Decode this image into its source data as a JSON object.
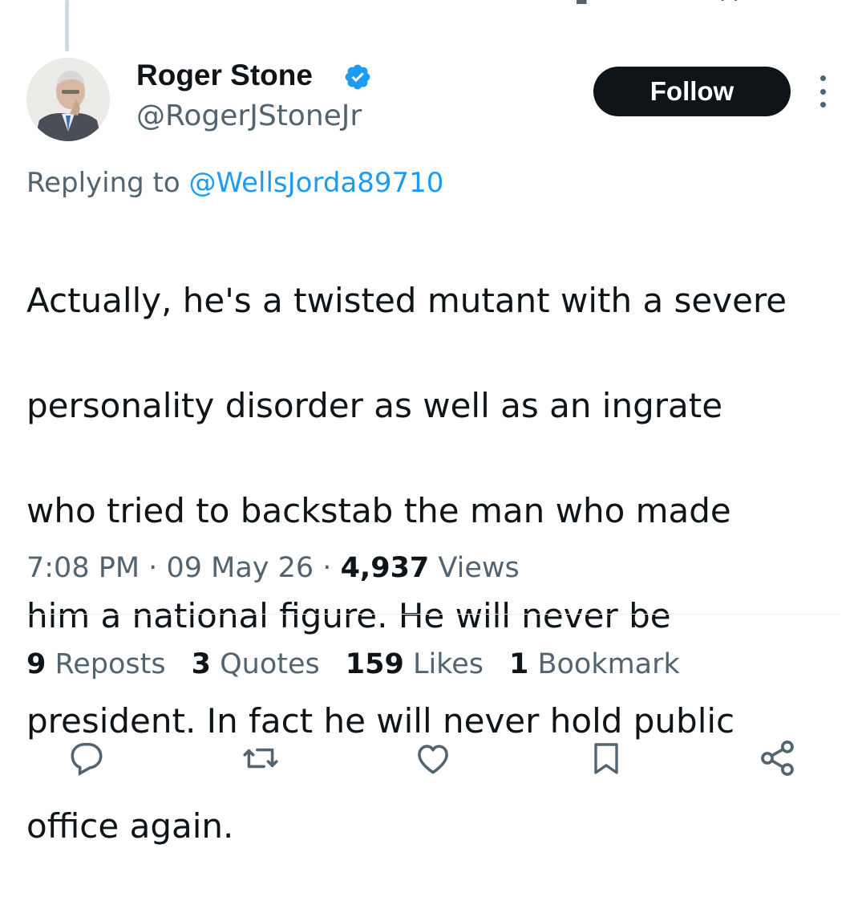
{
  "author": {
    "display_name": "Roger Stone",
    "handle": "@RogerJStoneJr",
    "verified": true,
    "verified_color": "#1d9bf0"
  },
  "follow_button": {
    "label": "Follow"
  },
  "reply": {
    "prefix": "Replying to",
    "mention": "@WellsJorda89710"
  },
  "tweet": {
    "lines": [
      "Actually, he's a twisted mutant with a severe",
      "personality disorder as well as an ingrate",
      "who tried to backstab the man who made",
      "him a national figure. He will never be",
      "president. In fact he will never hold public",
      "office again."
    ]
  },
  "meta": {
    "time": "7:08 PM",
    "separator": "·",
    "date": "09 May 26",
    "views_count": "4,937",
    "views_label": "Views"
  },
  "stats": [
    {
      "count": "9",
      "label": "Reposts"
    },
    {
      "count": "3",
      "label": "Quotes"
    },
    {
      "count": "159",
      "label": "Likes"
    },
    {
      "count": "1",
      "label": "Bookmark"
    }
  ],
  "actions": [
    "reply-icon",
    "repost-icon",
    "like-icon",
    "bookmark-icon",
    "share-icon"
  ],
  "colors": {
    "text": "#0f1419",
    "secondary": "#536471",
    "accent": "#1d9bf0",
    "divider": "#eff3f4"
  }
}
